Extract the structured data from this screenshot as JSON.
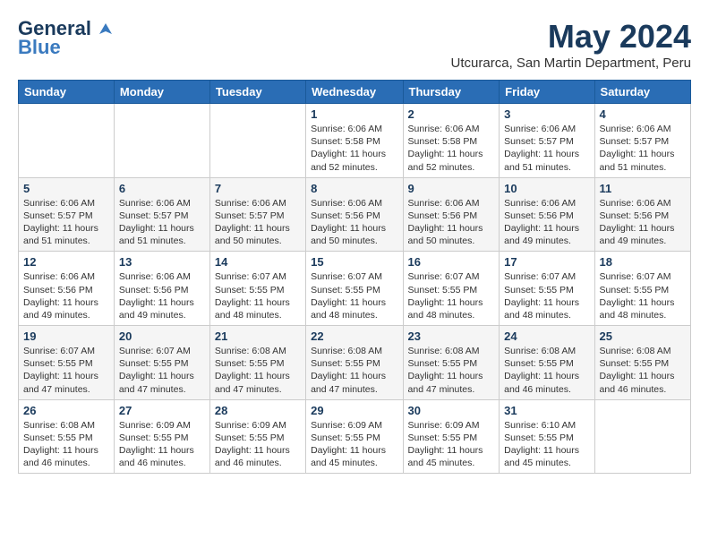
{
  "logo": {
    "general": "General",
    "blue": "Blue"
  },
  "header": {
    "month_year": "May 2024",
    "location": "Utcurarca, San Martin Department, Peru"
  },
  "weekdays": [
    "Sunday",
    "Monday",
    "Tuesday",
    "Wednesday",
    "Thursday",
    "Friday",
    "Saturday"
  ],
  "weeks": [
    [
      {
        "day": "",
        "info": ""
      },
      {
        "day": "",
        "info": ""
      },
      {
        "day": "",
        "info": ""
      },
      {
        "day": "1",
        "info": "Sunrise: 6:06 AM\nSunset: 5:58 PM\nDaylight: 11 hours and 52 minutes."
      },
      {
        "day": "2",
        "info": "Sunrise: 6:06 AM\nSunset: 5:58 PM\nDaylight: 11 hours and 52 minutes."
      },
      {
        "day": "3",
        "info": "Sunrise: 6:06 AM\nSunset: 5:57 PM\nDaylight: 11 hours and 51 minutes."
      },
      {
        "day": "4",
        "info": "Sunrise: 6:06 AM\nSunset: 5:57 PM\nDaylight: 11 hours and 51 minutes."
      }
    ],
    [
      {
        "day": "5",
        "info": "Sunrise: 6:06 AM\nSunset: 5:57 PM\nDaylight: 11 hours and 51 minutes."
      },
      {
        "day": "6",
        "info": "Sunrise: 6:06 AM\nSunset: 5:57 PM\nDaylight: 11 hours and 51 minutes."
      },
      {
        "day": "7",
        "info": "Sunrise: 6:06 AM\nSunset: 5:57 PM\nDaylight: 11 hours and 50 minutes."
      },
      {
        "day": "8",
        "info": "Sunrise: 6:06 AM\nSunset: 5:56 PM\nDaylight: 11 hours and 50 minutes."
      },
      {
        "day": "9",
        "info": "Sunrise: 6:06 AM\nSunset: 5:56 PM\nDaylight: 11 hours and 50 minutes."
      },
      {
        "day": "10",
        "info": "Sunrise: 6:06 AM\nSunset: 5:56 PM\nDaylight: 11 hours and 49 minutes."
      },
      {
        "day": "11",
        "info": "Sunrise: 6:06 AM\nSunset: 5:56 PM\nDaylight: 11 hours and 49 minutes."
      }
    ],
    [
      {
        "day": "12",
        "info": "Sunrise: 6:06 AM\nSunset: 5:56 PM\nDaylight: 11 hours and 49 minutes."
      },
      {
        "day": "13",
        "info": "Sunrise: 6:06 AM\nSunset: 5:56 PM\nDaylight: 11 hours and 49 minutes."
      },
      {
        "day": "14",
        "info": "Sunrise: 6:07 AM\nSunset: 5:55 PM\nDaylight: 11 hours and 48 minutes."
      },
      {
        "day": "15",
        "info": "Sunrise: 6:07 AM\nSunset: 5:55 PM\nDaylight: 11 hours and 48 minutes."
      },
      {
        "day": "16",
        "info": "Sunrise: 6:07 AM\nSunset: 5:55 PM\nDaylight: 11 hours and 48 minutes."
      },
      {
        "day": "17",
        "info": "Sunrise: 6:07 AM\nSunset: 5:55 PM\nDaylight: 11 hours and 48 minutes."
      },
      {
        "day": "18",
        "info": "Sunrise: 6:07 AM\nSunset: 5:55 PM\nDaylight: 11 hours and 48 minutes."
      }
    ],
    [
      {
        "day": "19",
        "info": "Sunrise: 6:07 AM\nSunset: 5:55 PM\nDaylight: 11 hours and 47 minutes."
      },
      {
        "day": "20",
        "info": "Sunrise: 6:07 AM\nSunset: 5:55 PM\nDaylight: 11 hours and 47 minutes."
      },
      {
        "day": "21",
        "info": "Sunrise: 6:08 AM\nSunset: 5:55 PM\nDaylight: 11 hours and 47 minutes."
      },
      {
        "day": "22",
        "info": "Sunrise: 6:08 AM\nSunset: 5:55 PM\nDaylight: 11 hours and 47 minutes."
      },
      {
        "day": "23",
        "info": "Sunrise: 6:08 AM\nSunset: 5:55 PM\nDaylight: 11 hours and 47 minutes."
      },
      {
        "day": "24",
        "info": "Sunrise: 6:08 AM\nSunset: 5:55 PM\nDaylight: 11 hours and 46 minutes."
      },
      {
        "day": "25",
        "info": "Sunrise: 6:08 AM\nSunset: 5:55 PM\nDaylight: 11 hours and 46 minutes."
      }
    ],
    [
      {
        "day": "26",
        "info": "Sunrise: 6:08 AM\nSunset: 5:55 PM\nDaylight: 11 hours and 46 minutes."
      },
      {
        "day": "27",
        "info": "Sunrise: 6:09 AM\nSunset: 5:55 PM\nDaylight: 11 hours and 46 minutes."
      },
      {
        "day": "28",
        "info": "Sunrise: 6:09 AM\nSunset: 5:55 PM\nDaylight: 11 hours and 46 minutes."
      },
      {
        "day": "29",
        "info": "Sunrise: 6:09 AM\nSunset: 5:55 PM\nDaylight: 11 hours and 45 minutes."
      },
      {
        "day": "30",
        "info": "Sunrise: 6:09 AM\nSunset: 5:55 PM\nDaylight: 11 hours and 45 minutes."
      },
      {
        "day": "31",
        "info": "Sunrise: 6:10 AM\nSunset: 5:55 PM\nDaylight: 11 hours and 45 minutes."
      },
      {
        "day": "",
        "info": ""
      }
    ]
  ]
}
